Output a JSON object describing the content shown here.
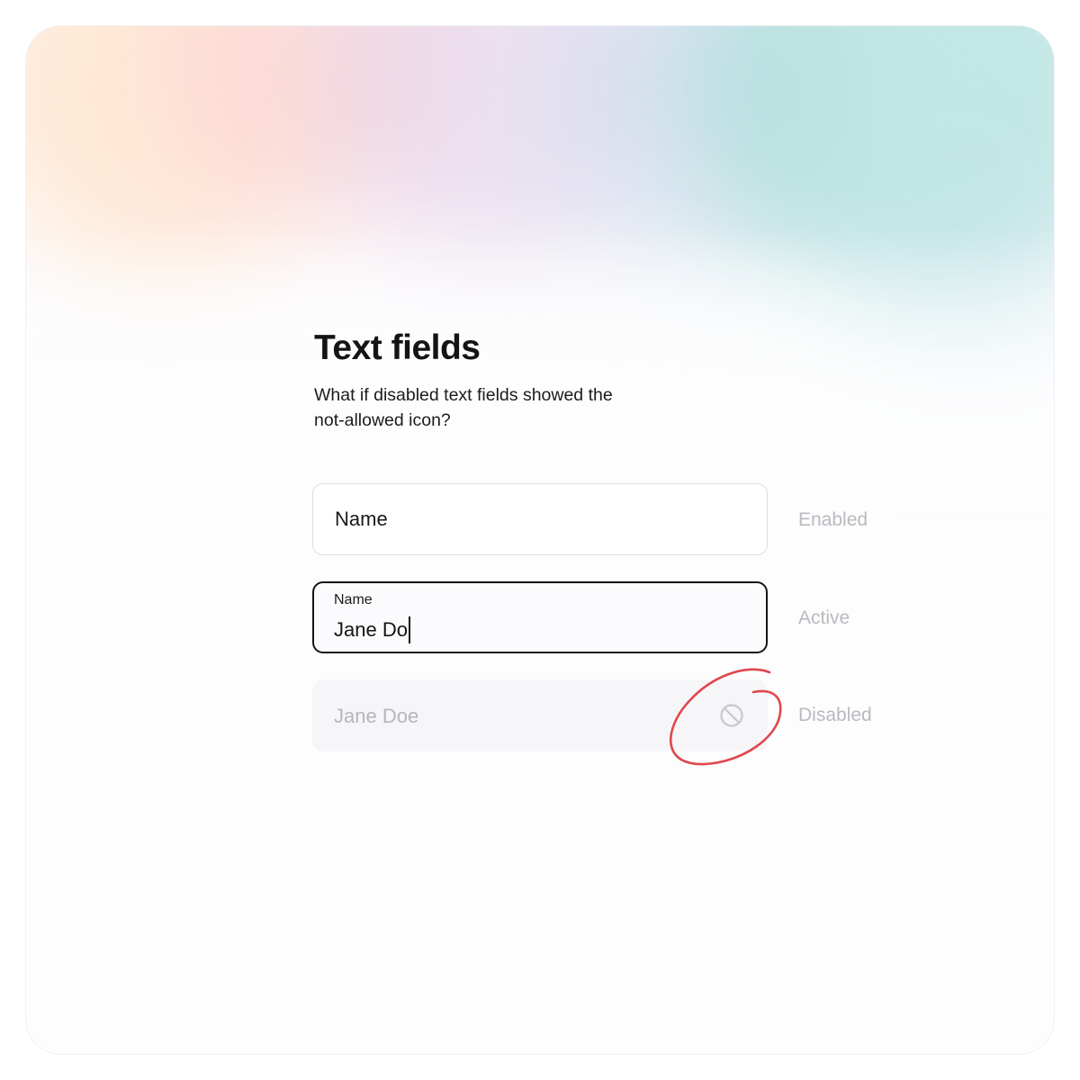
{
  "header": {
    "title": "Text fields",
    "subtitle": "What if disabled text fields showed the not-allowed icon?"
  },
  "fields": {
    "enabled": {
      "placeholder": "Name",
      "state_label": "Enabled"
    },
    "active": {
      "label": "Name",
      "value": "Jane Do",
      "state_label": "Active"
    },
    "disabled": {
      "value": "Jane Doe",
      "icon": "not-allowed-icon",
      "state_label": "Disabled"
    }
  },
  "colors": {
    "annotation": "#e0474c",
    "active_border": "#141414",
    "disabled_text": "#b5b5bb",
    "state_label": "#b9b9bf"
  }
}
